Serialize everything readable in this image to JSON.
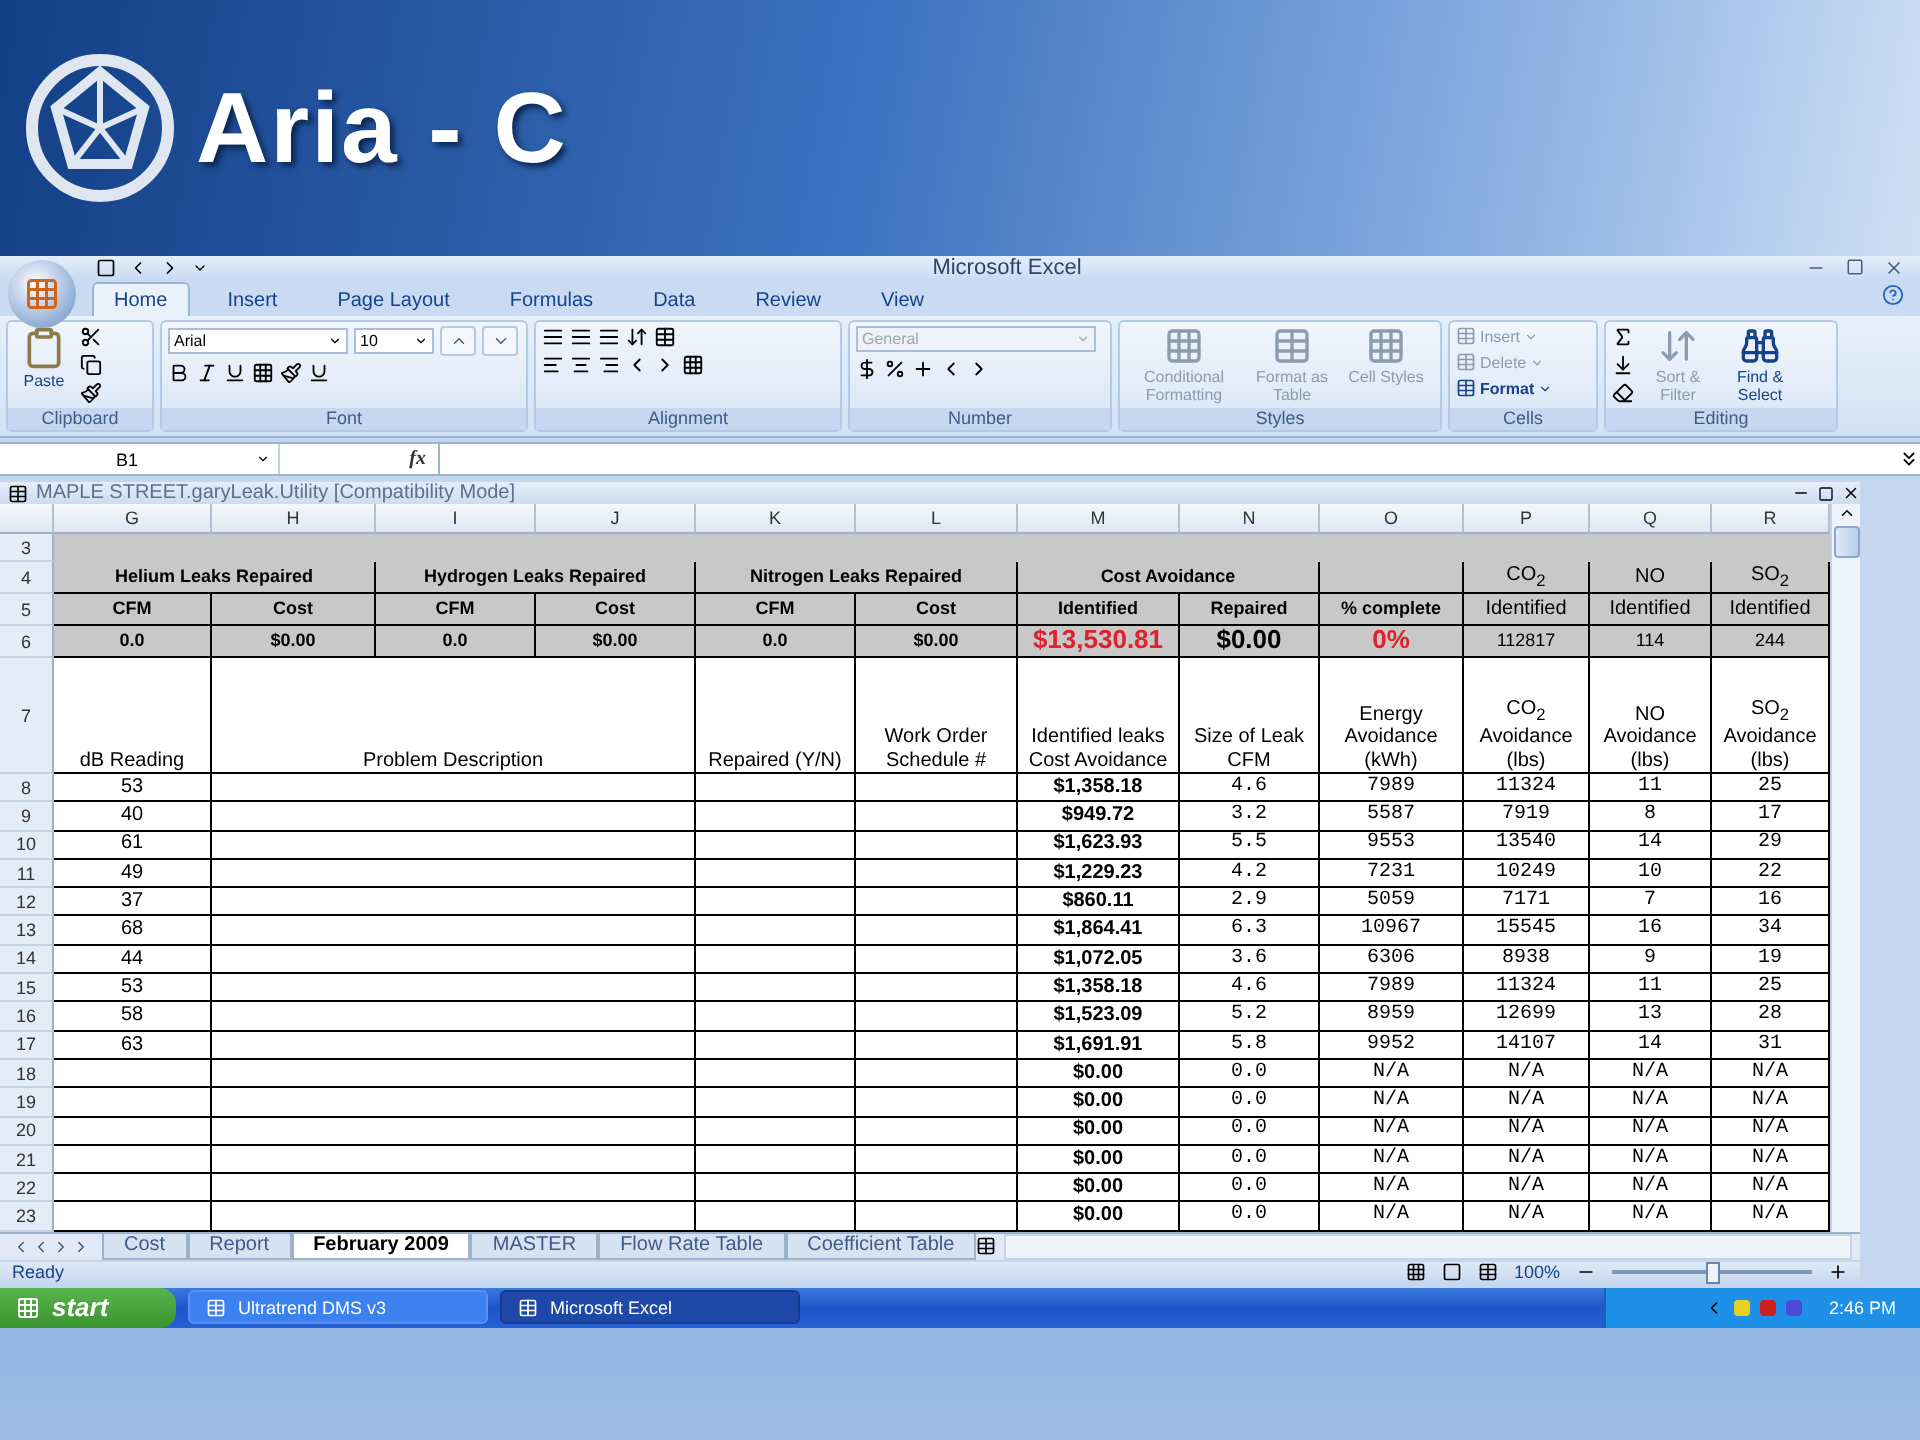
{
  "banner": {
    "title": "Aria - C"
  },
  "window": {
    "title": "Microsoft Excel"
  },
  "ribbon_tabs": [
    {
      "label": "Home",
      "selected": true
    },
    {
      "label": "Insert",
      "selected": false
    },
    {
      "label": "Page Layout",
      "selected": false
    },
    {
      "label": "Formulas",
      "selected": false
    },
    {
      "label": "Data",
      "selected": false
    },
    {
      "label": "Review",
      "selected": false
    },
    {
      "label": "View",
      "selected": false
    }
  ],
  "ribbon": {
    "clipboard": {
      "label": "Clipboard",
      "paste": "Paste"
    },
    "font": {
      "label": "Font",
      "name": "Arial",
      "size": "10"
    },
    "alignment": {
      "label": "Alignment"
    },
    "number": {
      "label": "Number",
      "format": "General"
    },
    "styles": {
      "label": "Styles",
      "buttons": [
        {
          "label": "Conditional Formatting",
          "disabled": true
        },
        {
          "label": "Format as Table",
          "disabled": true
        },
        {
          "label": "Cell Styles",
          "disabled": true
        }
      ]
    },
    "cells": {
      "label": "Cells",
      "buttons": [
        {
          "label": "Insert",
          "disabled": true
        },
        {
          "label": "Delete",
          "disabled": true
        },
        {
          "label": "Format",
          "disabled": false
        }
      ]
    },
    "editing": {
      "label": "Editing",
      "buttons": [
        {
          "label": "Sort & Filter",
          "disabled": true
        },
        {
          "label": "Find & Select",
          "disabled": false
        }
      ]
    }
  },
  "formula_bar": {
    "name_box": "B1",
    "function_label": "fx"
  },
  "workbook": {
    "title": "MAPLE STREET.garyLeak.Utility  [Compatibility Mode]"
  },
  "sheet": {
    "columns": [
      "G",
      "H",
      "I",
      "J",
      "K",
      "L",
      "M",
      "N",
      "O",
      "P",
      "Q",
      "R"
    ],
    "blank_row": "3",
    "group_row": {
      "number": "4",
      "groups": [
        "Helium Leaks Repaired",
        "Hydrogen Leaks Repaired",
        "Nitrogen Leaks Repaired",
        "Cost Avoidance"
      ],
      "pollutants": [
        "CO$_{2}$",
        "NO",
        "SO$_{2}$"
      ]
    },
    "subheader_row": {
      "number": "5",
      "cells": [
        "CFM",
        "Cost",
        "CFM",
        "Cost",
        "CFM",
        "Cost",
        "Identified",
        "Repaired",
        "% complete",
        "Identified",
        "Identified",
        "Identified"
      ]
    },
    "totals_row": {
      "number": "6",
      "cells": [
        {
          "text": "0.0",
          "color": "#000000"
        },
        {
          "text": "$0.00",
          "color": "#000000"
        },
        {
          "text": "0.0",
          "color": "#000000"
        },
        {
          "text": "$0.00",
          "color": "#000000"
        },
        {
          "text": "0.0",
          "color": "#000000"
        },
        {
          "text": "$0.00",
          "color": "#000000"
        },
        {
          "text": "$13,530.81",
          "color": "#e0202a"
        },
        {
          "text": "$0.00",
          "color": "#000000"
        },
        {
          "text": "0%",
          "color": "#e0202a"
        },
        {
          "text": "112817",
          "color": "#000000"
        },
        {
          "text": "114",
          "color": "#000000"
        },
        {
          "text": "244",
          "color": "#000000"
        }
      ]
    },
    "heading_row": {
      "number": "7",
      "cells": [
        "dB Reading",
        "Problem Description",
        "Repaired (Y/N)",
        "Work Order Schedule #",
        "Identified leaks Cost Avoidance",
        "Size of Leak CFM",
        "Energy Avoidance (kWh)",
        "CO$_{2}$ Avoidance (lbs)",
        "NO Avoidance (lbs)",
        "SO$_{2}$ Avoidance (lbs)"
      ]
    },
    "rows": [
      {
        "number": "8",
        "db": "53",
        "cost": "$1,358.18",
        "size": "4.6",
        "energy": "7989",
        "co2": "11324",
        "no": "11",
        "so2": "25"
      },
      {
        "number": "9",
        "db": "40",
        "cost": "$949.72",
        "size": "3.2",
        "energy": "5587",
        "co2": "7919",
        "no": "8",
        "so2": "17"
      },
      {
        "number": "10",
        "db": "61",
        "cost": "$1,623.93",
        "size": "5.5",
        "energy": "9553",
        "co2": "13540",
        "no": "14",
        "so2": "29"
      },
      {
        "number": "11",
        "db": "49",
        "cost": "$1,229.23",
        "size": "4.2",
        "energy": "7231",
        "co2": "10249",
        "no": "10",
        "so2": "22"
      },
      {
        "number": "12",
        "db": "37",
        "cost": "$860.11",
        "size": "2.9",
        "energy": "5059",
        "co2": "7171",
        "no": "7",
        "so2": "16"
      },
      {
        "number": "13",
        "db": "68",
        "cost": "$1,864.41",
        "size": "6.3",
        "energy": "10967",
        "co2": "15545",
        "no": "16",
        "so2": "34"
      },
      {
        "number": "14",
        "db": "44",
        "cost": "$1,072.05",
        "size": "3.6",
        "energy": "6306",
        "co2": "8938",
        "no": "9",
        "so2": "19"
      },
      {
        "number": "15",
        "db": "53",
        "cost": "$1,358.18",
        "size": "4.6",
        "energy": "7989",
        "co2": "11324",
        "no": "11",
        "so2": "25"
      },
      {
        "number": "16",
        "db": "58",
        "cost": "$1,523.09",
        "size": "5.2",
        "energy": "8959",
        "co2": "12699",
        "no": "13",
        "so2": "28"
      },
      {
        "number": "17",
        "db": "63",
        "cost": "$1,691.91",
        "size": "5.8",
        "energy": "9952",
        "co2": "14107",
        "no": "14",
        "so2": "31"
      },
      {
        "number": "18",
        "cost": "$0.00",
        "size": "0.0",
        "energy": "N/A",
        "co2": "N/A",
        "no": "N/A",
        "so2": "N/A"
      },
      {
        "number": "19",
        "cost": "$0.00",
        "size": "0.0",
        "energy": "N/A",
        "co2": "N/A",
        "no": "N/A",
        "so2": "N/A"
      },
      {
        "number": "20",
        "cost": "$0.00",
        "size": "0.0",
        "energy": "N/A",
        "co2": "N/A",
        "no": "N/A",
        "so2": "N/A"
      },
      {
        "number": "21",
        "cost": "$0.00",
        "size": "0.0",
        "energy": "N/A",
        "co2": "N/A",
        "no": "N/A",
        "so2": "N/A"
      },
      {
        "number": "22",
        "cost": "$0.00",
        "size": "0.0",
        "energy": "N/A",
        "co2": "N/A",
        "no": "N/A",
        "so2": "N/A"
      },
      {
        "number": "23",
        "cost": "$0.00",
        "size": "0.0",
        "energy": "N/A",
        "co2": "N/A",
        "no": "N/A",
        "so2": "N/A"
      }
    ]
  },
  "sheet_tabs": [
    {
      "label": "Cost",
      "selected": false
    },
    {
      "label": "Report",
      "selected": false
    },
    {
      "label": "February 2009",
      "selected": true
    },
    {
      "label": "MASTER",
      "selected": false
    },
    {
      "label": "Flow Rate Table",
      "selected": false
    },
    {
      "label": "Coefficient Table",
      "selected": false
    }
  ],
  "status_bar": {
    "text": "Ready",
    "zoom": "100%",
    "zoom_slider": {
      "level": 0.5
    }
  },
  "taskbar": {
    "start": "start",
    "items": [
      {
        "label": "Ultratrend DMS v3",
        "selected": false
      },
      {
        "label": "Microsoft Excel",
        "selected": true
      }
    ],
    "clock": "2:46 PM"
  }
}
